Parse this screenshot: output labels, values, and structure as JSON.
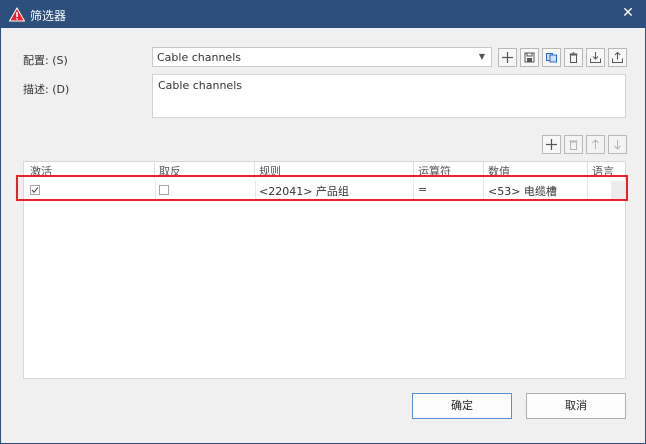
{
  "window": {
    "title": "筛选器",
    "icon": "warning-triangle-icon"
  },
  "config": {
    "label": "配置: (S)",
    "value": "Cable channels",
    "toolbar": [
      "add-icon",
      "save-icon",
      "copy-icon",
      "delete-icon",
      "import-icon",
      "export-icon"
    ]
  },
  "description": {
    "label": "描述: (D)",
    "value": "Cable channels"
  },
  "row_toolbar": [
    "add-icon",
    "delete-icon",
    "arrow-up-icon",
    "arrow-down-icon"
  ],
  "table": {
    "columns": [
      "激活",
      "取反",
      "规则",
      "运算符",
      "数值",
      "语言"
    ],
    "rows": [
      {
        "active": true,
        "negate": false,
        "rule": "<22041> 产品组",
        "operator": "=",
        "value": "<53> 电缆槽",
        "language": ""
      }
    ]
  },
  "buttons": {
    "ok": "确定",
    "cancel": "取消"
  },
  "colors": {
    "titlebar": "#2c4f7c",
    "highlight": "#e8212b",
    "accent": "#2c6bc4"
  }
}
